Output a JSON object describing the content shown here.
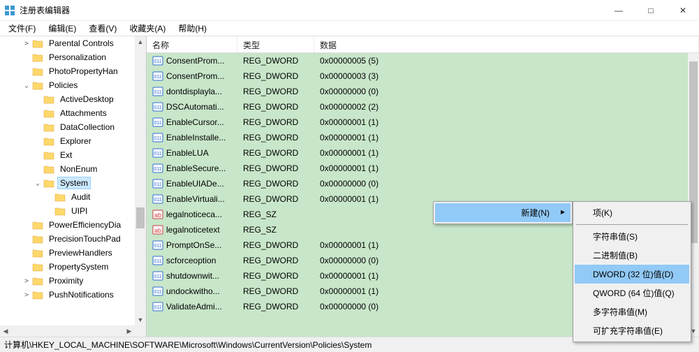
{
  "window": {
    "title": "注册表编辑器",
    "minimize": "—",
    "maximize": "□",
    "close": "✕"
  },
  "menubar": [
    "文件(F)",
    "编辑(E)",
    "查看(V)",
    "收藏夹(A)",
    "帮助(H)"
  ],
  "tree": [
    {
      "indent": 2,
      "expand": ">",
      "label": "Parental Controls"
    },
    {
      "indent": 2,
      "expand": "",
      "label": "Personalization"
    },
    {
      "indent": 2,
      "expand": "",
      "label": "PhotoPropertyHan"
    },
    {
      "indent": 2,
      "expand": "v",
      "label": "Policies"
    },
    {
      "indent": 3,
      "expand": "",
      "label": "ActiveDesktop"
    },
    {
      "indent": 3,
      "expand": "",
      "label": "Attachments"
    },
    {
      "indent": 3,
      "expand": "",
      "label": "DataCollection"
    },
    {
      "indent": 3,
      "expand": "",
      "label": "Explorer"
    },
    {
      "indent": 3,
      "expand": "",
      "label": "Ext"
    },
    {
      "indent": 3,
      "expand": "",
      "label": "NonEnum"
    },
    {
      "indent": 3,
      "expand": "v",
      "label": "System",
      "selected": true
    },
    {
      "indent": 4,
      "expand": "",
      "label": "Audit"
    },
    {
      "indent": 4,
      "expand": "",
      "label": "UIPI"
    },
    {
      "indent": 2,
      "expand": "",
      "label": "PowerEfficiencyDia"
    },
    {
      "indent": 2,
      "expand": "",
      "label": "PrecisionTouchPad"
    },
    {
      "indent": 2,
      "expand": "",
      "label": "PreviewHandlers"
    },
    {
      "indent": 2,
      "expand": "",
      "label": "PropertySystem"
    },
    {
      "indent": 2,
      "expand": ">",
      "label": "Proximity"
    },
    {
      "indent": 2,
      "expand": ">",
      "label": "PushNotifications"
    }
  ],
  "columns": {
    "name": "名称",
    "type": "类型",
    "data": "数据"
  },
  "rows": [
    {
      "icon": "bin",
      "name": "ConsentProm...",
      "type": "REG_DWORD",
      "data": "0x00000005 (5)"
    },
    {
      "icon": "bin",
      "name": "ConsentProm...",
      "type": "REG_DWORD",
      "data": "0x00000003 (3)"
    },
    {
      "icon": "bin",
      "name": "dontdisplayla...",
      "type": "REG_DWORD",
      "data": "0x00000000 (0)"
    },
    {
      "icon": "bin",
      "name": "DSCAutomati...",
      "type": "REG_DWORD",
      "data": "0x00000002 (2)"
    },
    {
      "icon": "bin",
      "name": "EnableCursor...",
      "type": "REG_DWORD",
      "data": "0x00000001 (1)"
    },
    {
      "icon": "bin",
      "name": "EnableInstalle...",
      "type": "REG_DWORD",
      "data": "0x00000001 (1)"
    },
    {
      "icon": "bin",
      "name": "EnableLUA",
      "type": "REG_DWORD",
      "data": "0x00000001 (1)"
    },
    {
      "icon": "bin",
      "name": "EnableSecure...",
      "type": "REG_DWORD",
      "data": "0x00000001 (1)"
    },
    {
      "icon": "bin",
      "name": "EnableUIADe...",
      "type": "REG_DWORD",
      "data": "0x00000000 (0)"
    },
    {
      "icon": "bin",
      "name": "EnableVirtuali...",
      "type": "REG_DWORD",
      "data": "0x00000001 (1)"
    },
    {
      "icon": "str",
      "name": "legalnoticeca...",
      "type": "REG_SZ",
      "data": ""
    },
    {
      "icon": "str",
      "name": "legalnoticetext",
      "type": "REG_SZ",
      "data": ""
    },
    {
      "icon": "bin",
      "name": "PromptOnSe...",
      "type": "REG_DWORD",
      "data": "0x00000001 (1)"
    },
    {
      "icon": "bin",
      "name": "scforceoption",
      "type": "REG_DWORD",
      "data": "0x00000000 (0)"
    },
    {
      "icon": "bin",
      "name": "shutdownwit...",
      "type": "REG_DWORD",
      "data": "0x00000001 (1)"
    },
    {
      "icon": "bin",
      "name": "undockwitho...",
      "type": "REG_DWORD",
      "data": "0x00000001 (1)"
    },
    {
      "icon": "bin",
      "name": "ValidateAdmi...",
      "type": "REG_DWORD",
      "data": "0x00000000 (0)"
    }
  ],
  "context_menu": {
    "items": [
      {
        "label": "项(K)"
      },
      {
        "sep": true
      },
      {
        "label": "字符串值(S)"
      },
      {
        "label": "二进制值(B)"
      },
      {
        "label": "DWORD (32 位)值(D)",
        "selected": true
      },
      {
        "label": "QWORD (64 位)值(Q)"
      },
      {
        "label": "多字符串值(M)"
      },
      {
        "label": "可扩充字符串值(E)"
      }
    ],
    "parent": {
      "label": "新建(N)",
      "arrow": "▸"
    }
  },
  "statusbar": "计算机\\HKEY_LOCAL_MACHINE\\SOFTWARE\\Microsoft\\Windows\\CurrentVersion\\Policies\\System"
}
